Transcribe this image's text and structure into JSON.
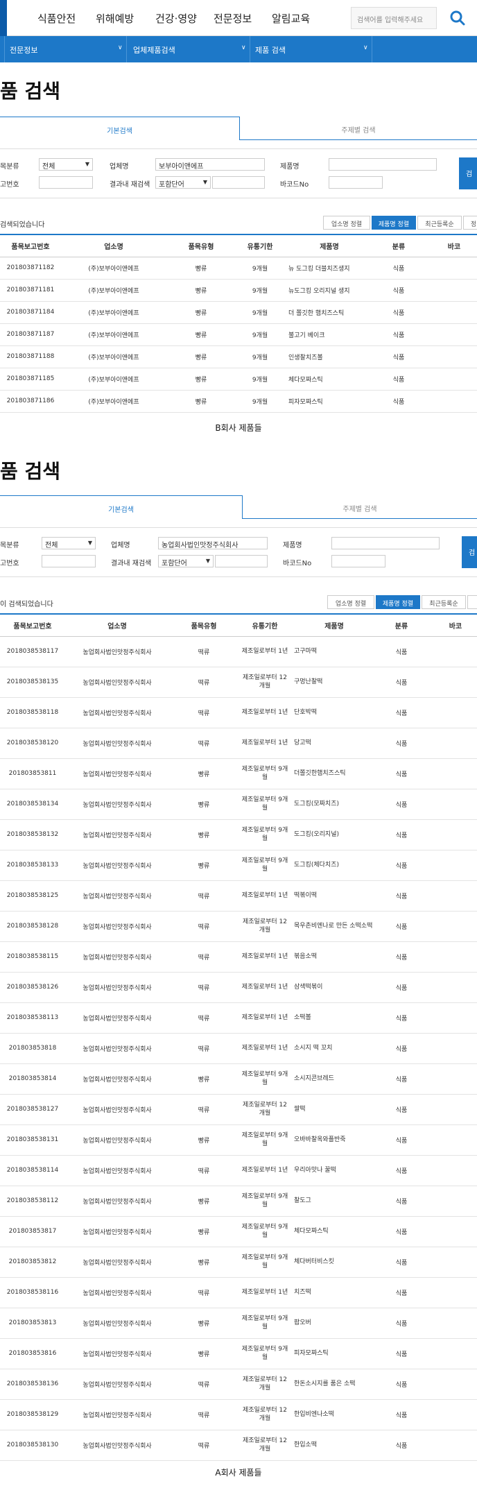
{
  "topnav": {
    "menu": [
      "식품안전",
      "위해예방",
      "건강·영양",
      "전문정보",
      "알림교육"
    ],
    "search_placeholder": "검색어를 입력해주세요"
  },
  "subnav": {
    "items": [
      "전문정보",
      "업체제품검색",
      "제품 검색"
    ]
  },
  "section1": {
    "title": "품 검색",
    "tabs": [
      "기본검색",
      "주제별 검색"
    ],
    "form": {
      "category_label": "목분류",
      "category_value": "전체",
      "company_label": "업체명",
      "company_value": "보부아이앤에프",
      "product_label": "제품명",
      "report_label": "고번호",
      "refine_label": "결과내 재검색",
      "refine_value": "포함단어",
      "barcode_label": "바코드No",
      "search_btn": "검"
    },
    "result_msg": "검색되었습니다",
    "sort": [
      "업소명 정렬",
      "제품명 정렬",
      "최근등록순",
      "정"
    ],
    "columns": [
      "품목보고번호",
      "업소명",
      "품목유형",
      "유통기한",
      "제품명",
      "분류",
      "바코"
    ],
    "rows": [
      [
        "201803871182",
        "(주)보부아이앤에프",
        "빵류",
        "9개월",
        "뉴 도그킹 더블치즈생지",
        "식품"
      ],
      [
        "201803871181",
        "(주)보부아이앤에프",
        "빵류",
        "9개월",
        "뉴도그킹 오리지널 생지",
        "식품"
      ],
      [
        "201803871184",
        "(주)보부아이앤에프",
        "빵류",
        "9개월",
        "더 쫄깃한 햄치즈스틱",
        "식품"
      ],
      [
        "201803871187",
        "(주)보부아이앤에프",
        "빵류",
        "9개월",
        "불고기 베이크",
        "식품"
      ],
      [
        "201803871188",
        "(주)보부아이앤에프",
        "빵류",
        "9개월",
        "인생찰치즈볼",
        "식품"
      ],
      [
        "201803871185",
        "(주)보부아이앤에프",
        "빵류",
        "9개월",
        "체다모짜스틱",
        "식품"
      ],
      [
        "201803871186",
        "(주)보부아이앤에프",
        "빵류",
        "9개월",
        "피자모짜스틱",
        "식품"
      ]
    ],
    "caption": "B회사 제품들"
  },
  "section2": {
    "title": "품 검색",
    "tabs": [
      "기본검색",
      "주제별 검색"
    ],
    "form": {
      "category_label": "목분류",
      "category_value": "전체",
      "company_label": "업체명",
      "company_value": "농업회사법인맛정주식회사",
      "product_label": "제품명",
      "report_label": "고번호",
      "refine_label": "결과내 재검색",
      "refine_value": "포함단어",
      "barcode_label": "바코드No",
      "search_btn": "검"
    },
    "result_msg": "이 검색되었습니다",
    "sort": [
      "업소명 정렬",
      "제품명 정렬",
      "최근등록순",
      ""
    ],
    "columns": [
      "품목보고번호",
      "업소명",
      "품목유형",
      "유통기한",
      "제품명",
      "분류",
      "바코"
    ],
    "rows": [
      [
        "201803853811​7",
        "농업회사법인맛정주식회사",
        "떡류",
        "제조일로부터 1년",
        "고구마떡",
        "식품"
      ],
      [
        "2018038538135",
        "농업회사법인맛정주식회사",
        "떡류",
        "제조일로부터 12개월",
        "구멍난찰떡",
        "식품"
      ],
      [
        "2018038538118",
        "농업회사법인맛정주식회사",
        "떡류",
        "제조일로부터 1년",
        "단호박떡",
        "식품"
      ],
      [
        "2018038538120",
        "농업회사법인맛정주식회사",
        "떡류",
        "제조일로부터 1년",
        "당고떡",
        "식품"
      ],
      [
        "201803853811",
        "농업회사법인맛정주식회사",
        "빵류",
        "제조일로부터 9개월",
        "더쫄깃한햄치즈스틱",
        "식품"
      ],
      [
        "2018038538134",
        "농업회사법인맛정주식회사",
        "빵류",
        "제조일로부터 9개월",
        "도그킹(모짜치즈)",
        "식품"
      ],
      [
        "2018038538132",
        "농업회사법인맛정주식회사",
        "빵류",
        "제조일로부터 9개월",
        "도그킹(오리지널)",
        "식품"
      ],
      [
        "2018038538133",
        "농업회사법인맛정주식회사",
        "빵류",
        "제조일로부터 9개월",
        "도그킹(체다치즈)",
        "식품"
      ],
      [
        "2018038538125",
        "농업회사법인맛정주식회사",
        "떡류",
        "제조일로부터 1년",
        "떡볶이떡",
        "식품"
      ],
      [
        "2018038538128",
        "농업회사법인맛정주식회사",
        "떡류",
        "제조일로부터 12개월",
        "목우촌비엔나로 만든 소떡소떡",
        "식품"
      ],
      [
        "2018038538115",
        "농업회사법인맛정주식회사",
        "떡류",
        "제조일로부터 1년",
        "볶음소떡",
        "식품"
      ],
      [
        "2018038538126",
        "농업회사법인맛정주식회사",
        "떡류",
        "제조일로부터 1년",
        "삼색떡볶이",
        "식품"
      ],
      [
        "2018038538113",
        "농업회사법인맛정주식회사",
        "떡류",
        "제조일로부터 1년",
        "소떡볼",
        "식품"
      ],
      [
        "201803853818",
        "농업회사법인맛정주식회사",
        "떡류",
        "제조일로부터 1년",
        "소시지 떡 꼬치",
        "식품"
      ],
      [
        "201803853814",
        "농업회사법인맛정주식회사",
        "빵류",
        "제조일로부터 9개월",
        "소시지콘브레드",
        "식품"
      ],
      [
        "2018038538127",
        "농업회사법인맛정주식회사",
        "떡류",
        "제조일로부터 12개월",
        "쌀떡",
        "식품"
      ],
      [
        "2018038538131",
        "농업회사법인맛정주식회사",
        "빵류",
        "제조일로부터 9개월",
        "오바바찰옥와플반죽",
        "식품"
      ],
      [
        "2018038538114",
        "농업회사법인맛정주식회사",
        "떡류",
        "제조일로부터 1년",
        "우리아맛나 꿀떡",
        "식품"
      ],
      [
        "2018038538112",
        "농업회사법인맛정주식회사",
        "빵류",
        "제조일로부터 9개월",
        "찰도그",
        "식품"
      ],
      [
        "201803853817",
        "농업회사법인맛정주식회사",
        "빵류",
        "제조일로부터 9개월",
        "체다모짜스틱",
        "식품"
      ],
      [
        "201803853812",
        "농업회사법인맛정주식회사",
        "빵류",
        "제조일로부터 9개월",
        "체다버터비스킷",
        "식품"
      ],
      [
        "2018038538116",
        "농업회사법인맛정주식회사",
        "떡류",
        "제조일로부터 1년",
        "치즈떡",
        "식품"
      ],
      [
        "201803853813",
        "농업회사법인맛정주식회사",
        "빵류",
        "제조일로부터 9개월",
        "팝오버",
        "식품"
      ],
      [
        "201803853816",
        "농업회사법인맛정주식회사",
        "빵류",
        "제조일로부터 9개월",
        "피자모짜스틱",
        "식품"
      ],
      [
        "2018038538136",
        "농업회사법인맛정주식회사",
        "떡류",
        "제조일로부터 12개월",
        "한돈소시지를 품은 소떡",
        "식품"
      ],
      [
        "2018038538129",
        "농업회사법인맛정주식회사",
        "떡류",
        "제조일로부터 12개월",
        "한입비엔나소떡",
        "식품"
      ],
      [
        "2018038538130",
        "농업회사법인맛정주식회사",
        "떡류",
        "제조일로부터 12개월",
        "한입소떡",
        "식품"
      ]
    ],
    "caption": "A회사 제품들"
  }
}
